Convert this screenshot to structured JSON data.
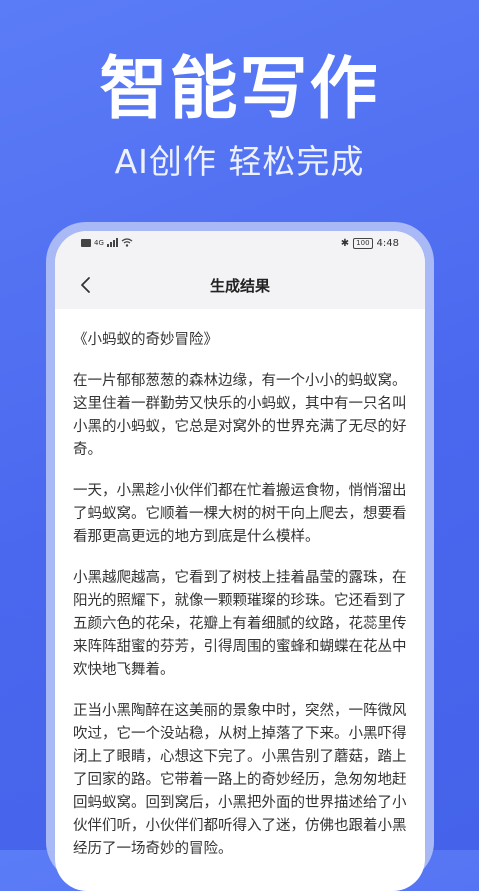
{
  "hero": {
    "title": "智能写作",
    "subtitle": "AI创作  轻松完成"
  },
  "status_bar": {
    "network": "4G",
    "battery": "100",
    "time": "4:48"
  },
  "nav": {
    "back_icon": "chevron-left-icon",
    "title": "生成结果"
  },
  "article": {
    "title": "《小蚂蚁的奇妙冒险》",
    "paragraphs": [
      "在一片郁郁葱葱的森林边缘，有一个小小的蚂蚁窝。这里住着一群勤劳又快乐的小蚂蚁，其中有一只名叫小黑的小蚂蚁，它总是对窝外的世界充满了无尽的好奇。",
      "一天，小黑趁小伙伴们都在忙着搬运食物，悄悄溜出了蚂蚁窝。它顺着一棵大树的树干向上爬去，想要看看那更高更远的地方到底是什么模样。",
      "小黑越爬越高，它看到了树枝上挂着晶莹的露珠，在阳光的照耀下，就像一颗颗璀璨的珍珠。它还看到了五颜六色的花朵，花瓣上有着细腻的纹路，花蕊里传来阵阵甜蜜的芬芳，引得周围的蜜蜂和蝴蝶在花丛中欢快地飞舞着。",
      "正当小黑陶醉在这美丽的景象中时，突然，一阵微风吹过，它一个没站稳，从树上掉落了下来。小黑吓得闭上了眼睛，心想这下完了。小黑告别了蘑菇，踏上了回家的路。它带着一路上的奇妙经历，急匆匆地赶回蚂蚁窝。回到窝后，小黑把外面的世界描述给了小伙伴们听，小伙伴们都听得入了迷，仿佛也跟着小黑经历了一场奇妙的冒险。"
    ]
  },
  "colors": {
    "background": "#4a68ee",
    "phone_frame": "#a9b9f6",
    "screen": "#ffffff",
    "header": "#f3f3f5"
  }
}
